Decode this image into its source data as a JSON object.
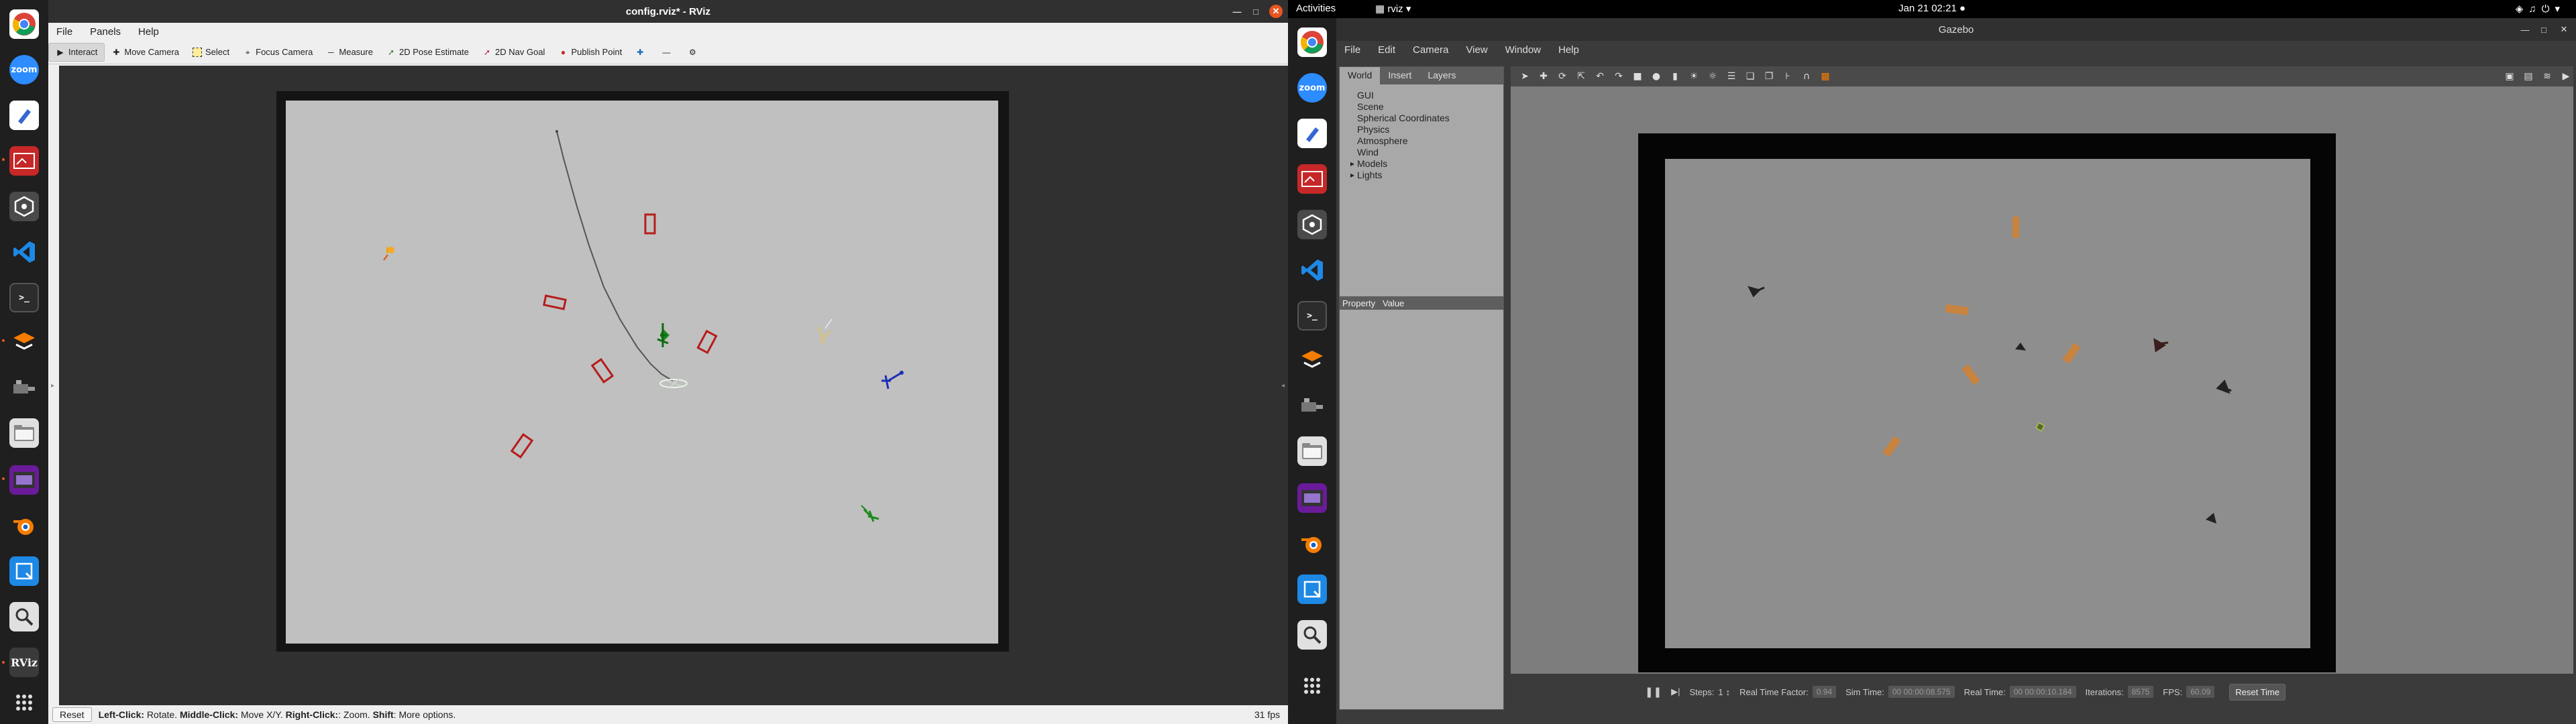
{
  "rviz": {
    "window_title": "config.rviz* - RViz",
    "menu": [
      "File",
      "Panels",
      "Help"
    ],
    "tools": [
      {
        "label": "Interact",
        "icon": "interact-icon"
      },
      {
        "label": "Move Camera",
        "icon": "move-camera-icon"
      },
      {
        "label": "Select",
        "icon": "select-icon"
      },
      {
        "label": "Focus Camera",
        "icon": "focus-camera-icon"
      },
      {
        "label": "Measure",
        "icon": "measure-icon"
      },
      {
        "label": "2D Pose Estimate",
        "icon": "pose-estimate-icon"
      },
      {
        "label": "2D Nav Goal",
        "icon": "nav-goal-icon"
      },
      {
        "label": "Publish Point",
        "icon": "publish-point-icon"
      }
    ],
    "status": {
      "reset_label": "Reset",
      "hint_left_click": "Left-Click:",
      "hint_left_click_desc": " Rotate. ",
      "hint_middle_click": "Middle-Click:",
      "hint_middle_click_desc": " Move X/Y. ",
      "hint_right_click": "Right-Click:",
      "hint_right_click_desc": ": Zoom. ",
      "hint_shift": "Shift",
      "hint_shift_desc": ": More options.",
      "fps": "31 fps"
    }
  },
  "topbar": {
    "activities": "Activities",
    "app_name": "rviz",
    "clock": "Jan 21  02:21",
    "status_icons": [
      "network-icon",
      "volume-icon",
      "power-icon"
    ]
  },
  "gazebo": {
    "window_title": "Gazebo",
    "menu": [
      "File",
      "Edit",
      "Camera",
      "View",
      "Window",
      "Help"
    ],
    "tabs": [
      "World",
      "Insert",
      "Layers"
    ],
    "tree": [
      "GUI",
      "Scene",
      "Spherical Coordinates",
      "Physics",
      "Atmosphere",
      "Wind",
      "Models",
      "Lights"
    ],
    "property_header": {
      "property": "Property",
      "value": "Value"
    },
    "bottom": {
      "steps_label": "Steps:",
      "steps_value": "1",
      "rtf_label": "Real Time Factor:",
      "rtf_value": "0.94",
      "sim_time_label": "Sim Time:",
      "sim_time_value": "00 00:00:08.575",
      "real_time_label": "Real Time:",
      "real_time_value": "00 00:00:10.184",
      "iterations_label": "Iterations:",
      "iterations_value": "8575",
      "fps_label": "FPS:",
      "fps_value": "60.09",
      "reset_label": "Reset Time"
    }
  },
  "dock": {
    "left_icons": [
      "chrome-icon",
      "zoom-icon",
      "text-editor-icon",
      "screenshot-icon",
      "unity-icon",
      "vscode-icon",
      "terminal-icon",
      "stack-icon",
      "gazebo-icon",
      "files-icon",
      "video-icon",
      "blender-icon",
      "screen-capture-icon",
      "search-icon",
      "rviz-icon",
      "app-grid-icon"
    ],
    "zoom_label": "zoom",
    "rviz_label": "RViz"
  }
}
